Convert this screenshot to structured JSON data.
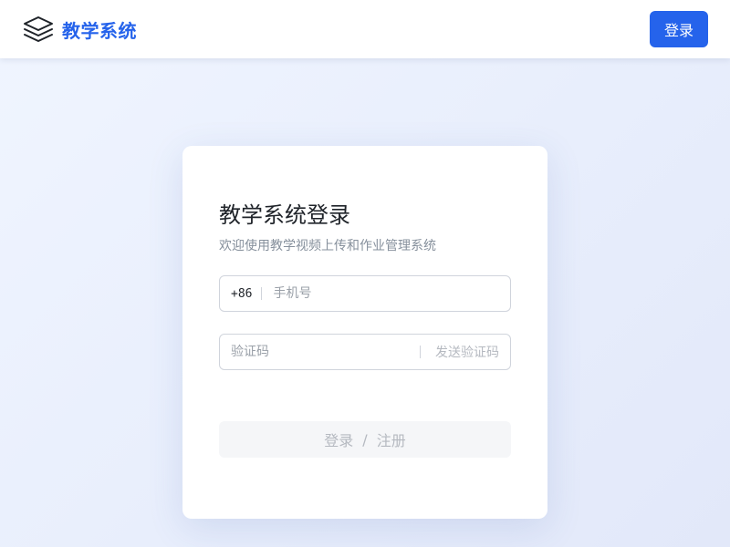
{
  "header": {
    "logo_icon": "stacked-layers-icon",
    "brand_name": "教学系统",
    "login_label": "登录"
  },
  "card": {
    "title": "教学系统登录",
    "subtitle": "欢迎使用教学视频上传和作业管理系统",
    "phone": {
      "prefix": "+86",
      "value": "",
      "placeholder": "手机号"
    },
    "code": {
      "value": "",
      "placeholder": "验证码",
      "send_label": "发送验证码"
    },
    "submit": {
      "login_label": "登录",
      "separator": "/",
      "register_label": "注册",
      "disabled": true
    }
  },
  "colors": {
    "accent": "#2563eb",
    "disabled_text": "#b5b9c0",
    "disabled_bg": "#f5f6f8",
    "text_primary": "#1f2329",
    "text_secondary": "#86909c"
  }
}
